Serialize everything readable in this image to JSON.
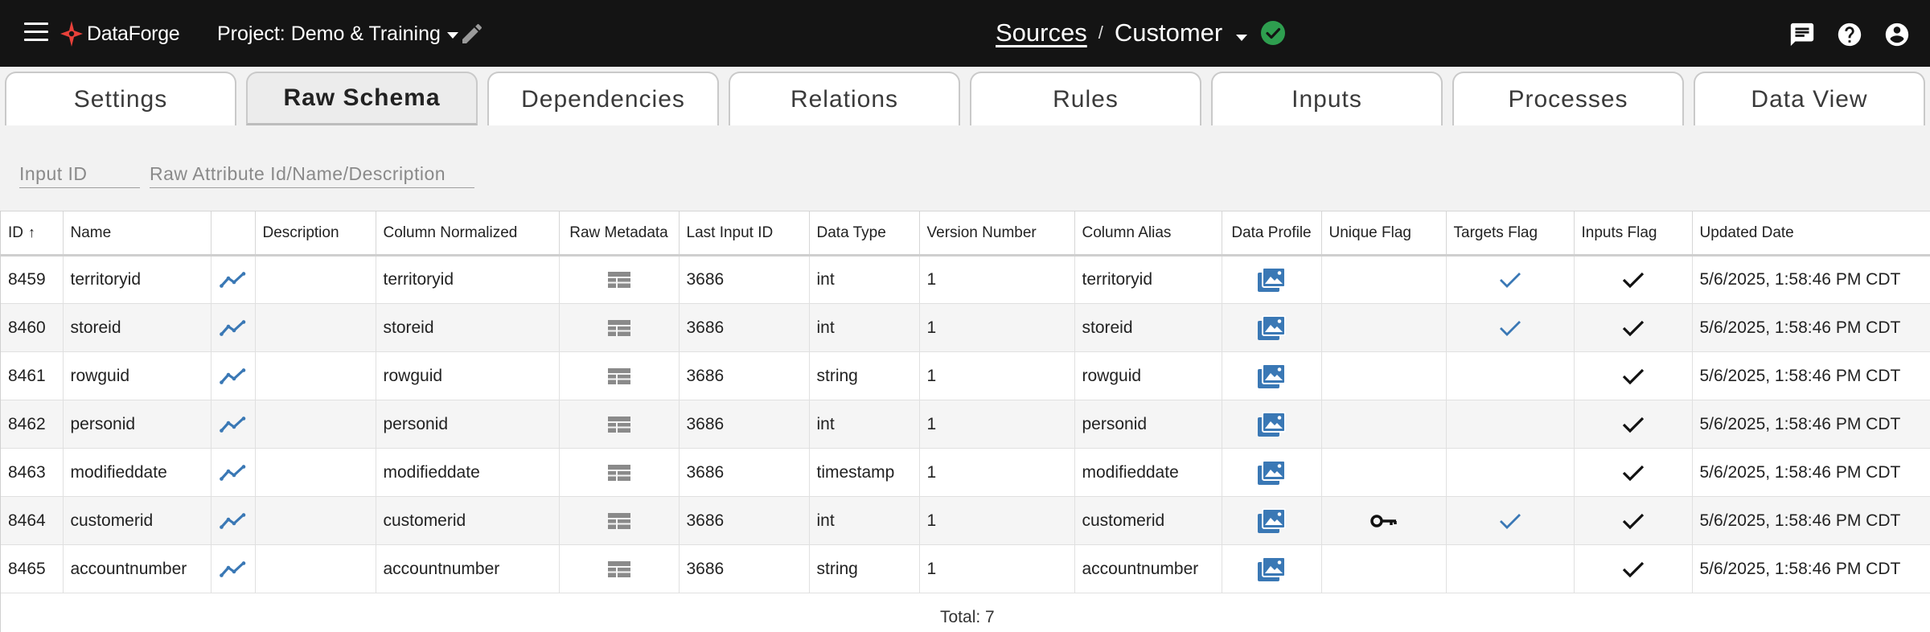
{
  "app": {
    "name": "DataForge",
    "project_label": "Project: Demo & Training"
  },
  "breadcrumb": {
    "parent": "Sources",
    "separator": "/",
    "current": "Customer"
  },
  "colors": {
    "topbar_bg": "#141414",
    "status_ok": "#2e9e4f",
    "accent_blue": "#3a78b5",
    "logo_red": "#e8413a"
  },
  "tabs": [
    {
      "label": "Settings",
      "active": false
    },
    {
      "label": "Raw Schema",
      "active": true
    },
    {
      "label": "Dependencies",
      "active": false
    },
    {
      "label": "Relations",
      "active": false
    },
    {
      "label": "Rules",
      "active": false
    },
    {
      "label": "Inputs",
      "active": false
    },
    {
      "label": "Processes",
      "active": false
    },
    {
      "label": "Data View",
      "active": false
    }
  ],
  "filters": {
    "input_id_placeholder": "Input ID",
    "attribute_placeholder": "Raw Attribute Id/Name/Description"
  },
  "table": {
    "columns": [
      "ID",
      "Name",
      "",
      "Description",
      "Column Normalized",
      "Raw Metadata",
      "Last Input ID",
      "Data Type",
      "Version Number",
      "Column Alias",
      "Data Profile",
      "Unique Flag",
      "Targets Flag",
      "Inputs Flag",
      "Updated Date"
    ],
    "sort": {
      "column": "ID",
      "direction": "ascending"
    },
    "rows": [
      {
        "id": "8459",
        "name": "territoryid",
        "description": "",
        "column_normalized": "territoryid",
        "last_input_id": "3686",
        "data_type": "int",
        "version_number": "1",
        "column_alias": "territoryid",
        "unique_flag": false,
        "targets_flag": true,
        "inputs_flag": true,
        "updated_date": "5/6/2025, 1:58:46 PM CDT"
      },
      {
        "id": "8460",
        "name": "storeid",
        "description": "",
        "column_normalized": "storeid",
        "last_input_id": "3686",
        "data_type": "int",
        "version_number": "1",
        "column_alias": "storeid",
        "unique_flag": false,
        "targets_flag": true,
        "inputs_flag": true,
        "updated_date": "5/6/2025, 1:58:46 PM CDT"
      },
      {
        "id": "8461",
        "name": "rowguid",
        "description": "",
        "column_normalized": "rowguid",
        "last_input_id": "3686",
        "data_type": "string",
        "version_number": "1",
        "column_alias": "rowguid",
        "unique_flag": false,
        "targets_flag": false,
        "inputs_flag": true,
        "updated_date": "5/6/2025, 1:58:46 PM CDT"
      },
      {
        "id": "8462",
        "name": "personid",
        "description": "",
        "column_normalized": "personid",
        "last_input_id": "3686",
        "data_type": "int",
        "version_number": "1",
        "column_alias": "personid",
        "unique_flag": false,
        "targets_flag": false,
        "inputs_flag": true,
        "updated_date": "5/6/2025, 1:58:46 PM CDT"
      },
      {
        "id": "8463",
        "name": "modifieddate",
        "description": "",
        "column_normalized": "modifieddate",
        "last_input_id": "3686",
        "data_type": "timestamp",
        "version_number": "1",
        "column_alias": "modifieddate",
        "unique_flag": false,
        "targets_flag": false,
        "inputs_flag": true,
        "updated_date": "5/6/2025, 1:58:46 PM CDT"
      },
      {
        "id": "8464",
        "name": "customerid",
        "description": "",
        "column_normalized": "customerid",
        "last_input_id": "3686",
        "data_type": "int",
        "version_number": "1",
        "column_alias": "customerid",
        "unique_flag": true,
        "targets_flag": true,
        "inputs_flag": true,
        "updated_date": "5/6/2025, 1:58:46 PM CDT"
      },
      {
        "id": "8465",
        "name": "accountnumber",
        "description": "",
        "column_normalized": "accountnumber",
        "last_input_id": "3686",
        "data_type": "string",
        "version_number": "1",
        "column_alias": "accountnumber",
        "unique_flag": false,
        "targets_flag": false,
        "inputs_flag": true,
        "updated_date": "5/6/2025, 1:58:46 PM CDT"
      }
    ],
    "footer": "Total: 7"
  },
  "icons": {
    "menu": "hamburger-menu-icon",
    "edit": "pencil-icon",
    "status": "check-circle-icon",
    "chat": "chat-icon",
    "help": "help-icon",
    "account": "account-circle-icon",
    "trend": "trending-line-icon",
    "metadata": "table-icon",
    "profile": "image-gallery-icon",
    "unique": "key-icon",
    "targets": "checkmark-icon",
    "inputs": "checkmark-icon"
  }
}
